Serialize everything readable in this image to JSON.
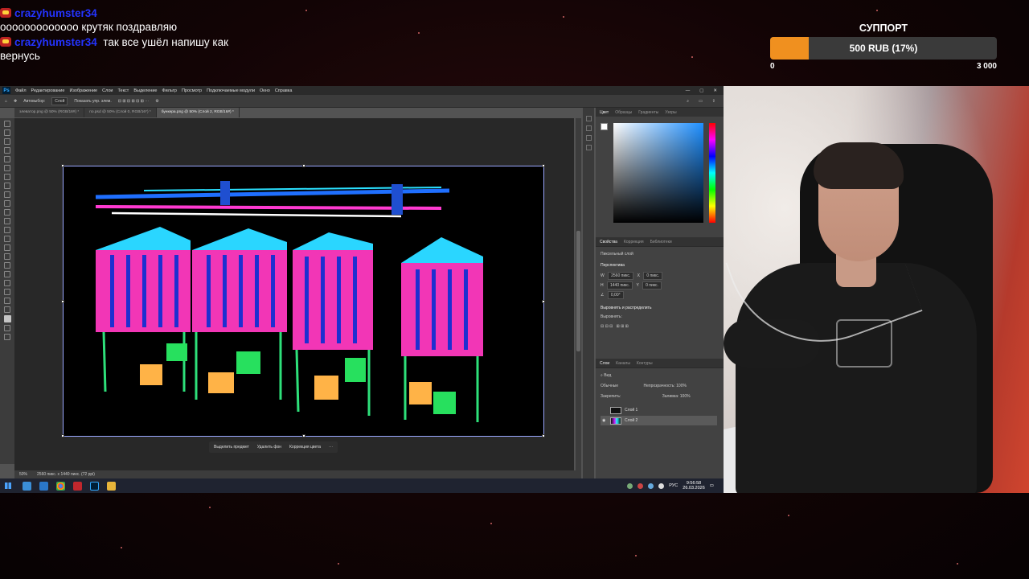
{
  "chat": {
    "messages": [
      {
        "user": "",
        "text": "ооооооооооооо крутяк поздравляю"
      },
      {
        "user": "crazyhumster34",
        "text": "так все ушёл напишу как вернусь"
      }
    ],
    "first_user": "crazyhumster34"
  },
  "support": {
    "title": "СУППОРТ",
    "label": "500 RUB (17%)",
    "progress_fraction": 0.17,
    "min": "0",
    "max": "3 000",
    "fill_color": "#f0901f"
  },
  "photoshop": {
    "logo": "Ps",
    "menu": [
      "Файл",
      "Редактирование",
      "Изображение",
      "Слои",
      "Текст",
      "Выделение",
      "Фильтр",
      "Просмотр",
      "Подключаемые модули",
      "Окно",
      "Справка"
    ],
    "options": {
      "autoselect": "Автовыбор:",
      "layer": "Слой",
      "transform": "Показать упр. элем."
    },
    "tabs": [
      "элеватор.png @ 50% (RGB/16#) *",
      "по.psd @ 50% (Слой 0, RGB/16*) *",
      "бункера.png @ 50% (Слой 2, RGB/16#) *"
    ],
    "context_bar": {
      "select": "Выделить предмет",
      "remove_bg": "Удалить фон",
      "color_correct": "Коррекция цвета"
    },
    "status": {
      "zoom": "50%",
      "size": "2560 пикс. x 1440 пикс. (72 ppi)"
    },
    "panels": {
      "color_tabs": [
        "Цвет",
        "Образцы",
        "Градиенты",
        "Узоры"
      ],
      "props_tabs": [
        "Свойства",
        "Коррекция",
        "Библиотеки"
      ],
      "pixel_layer": "Пиксельный слой",
      "transform_title": "Перспектива",
      "w": "2560 пикс.",
      "h": "1440 пикс.",
      "x": "0 пикс.",
      "y": "0 пикс.",
      "angle": "0,00°",
      "align_title": "Выровнять и распределить",
      "align_label": "Выровнять:",
      "layers_tabs": [
        "Слои",
        "Каналы",
        "Контуры"
      ],
      "kind": "Вид",
      "blend": "Обычные",
      "opacity_label": "Непрозрачность:",
      "opacity": "100%",
      "lock_label": "Закрепить:",
      "fill_label": "Заливка:",
      "fill": "100%",
      "layers": [
        {
          "name": "Слой 1",
          "selected": false
        },
        {
          "name": "Слой 2",
          "selected": true
        }
      ]
    }
  },
  "taskbar": {
    "lang": "РУС",
    "time": "9:56:58",
    "date": "26.03.2026"
  }
}
